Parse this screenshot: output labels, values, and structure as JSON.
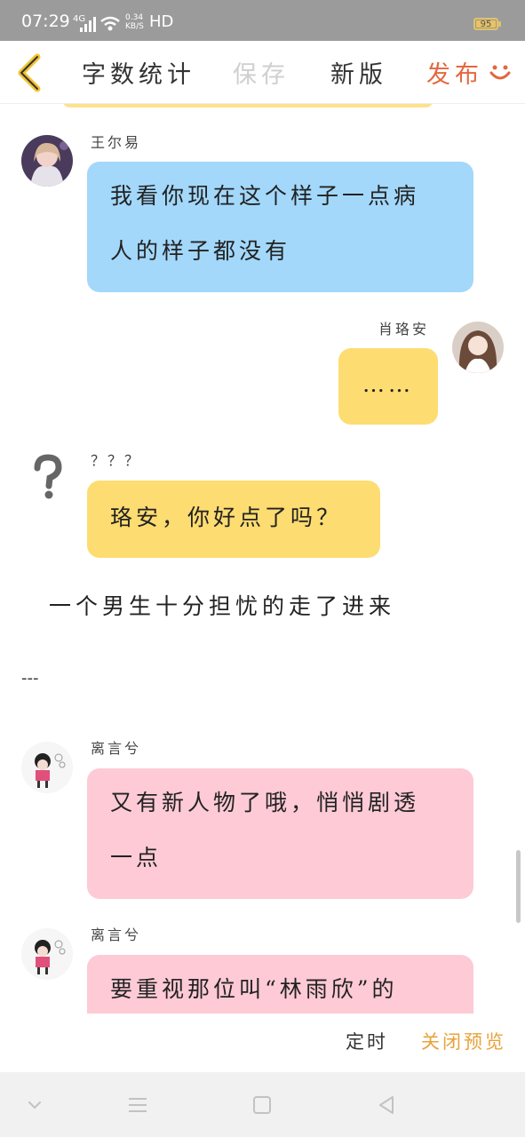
{
  "status": {
    "time": "07:29",
    "network": "4G",
    "speed_value": "0.34",
    "speed_unit": "KB/S",
    "hd": "HD",
    "battery": "95"
  },
  "toolbar": {
    "stats_label": "字数统计",
    "save_label": "保存",
    "new_version_label": "新版",
    "publish_label": "发布"
  },
  "messages": [
    {
      "sender": "王尔易",
      "lines": [
        "我看你现在这个样子一点病",
        "人的样子都没有"
      ]
    },
    {
      "sender": "肖珞安",
      "lines": [
        "……"
      ]
    },
    {
      "sender": "？？？",
      "lines": [
        "珞安，你好点了吗？"
      ]
    },
    {
      "sender": "离言兮",
      "lines": [
        "又有新人物了哦，悄悄剧透",
        "一点"
      ]
    },
    {
      "sender": "离言兮",
      "lines": [
        "要重视那位叫“林雨欣”的"
      ]
    }
  ],
  "narration": "一个男生十分担忧的走了进来",
  "divider": "---",
  "bottom": {
    "timer_label": "定时",
    "close_preview_label": "关闭预览"
  },
  "colors": {
    "accent_orange": "#e3673f",
    "preview_orange": "#e8a33b",
    "bubble_blue": "#a3d8fb",
    "bubble_yellow": "#fddc71",
    "bubble_pink": "#fdcad6"
  }
}
